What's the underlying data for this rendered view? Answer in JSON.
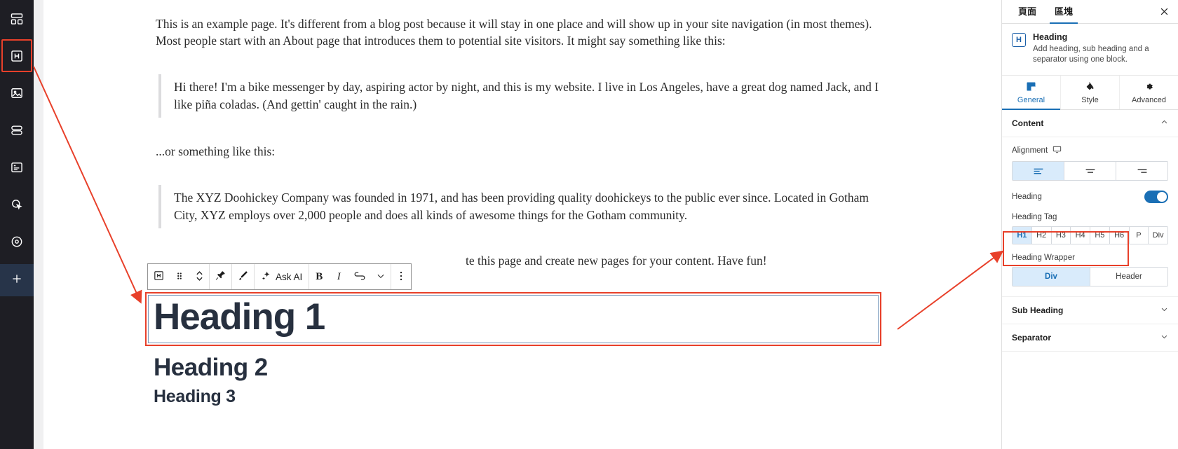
{
  "rail": {
    "items": [
      {
        "name": "layout-icon",
        "label": "Layout"
      },
      {
        "name": "heading-icon",
        "label": "Heading"
      },
      {
        "name": "image-icon",
        "label": "Image"
      },
      {
        "name": "list-icon",
        "label": "List"
      },
      {
        "name": "card-icon",
        "label": "Card"
      },
      {
        "name": "interaction-icon",
        "label": "Interaction"
      },
      {
        "name": "settings-icon",
        "label": "Settings"
      }
    ],
    "add_label": "+"
  },
  "document": {
    "paragraph_1": "This is an example page. It's different from a blog post because it will stay in one place and will show up in your site navigation (in most themes). Most people start with an About page that introduces them to potential site visitors. It might say something like this:",
    "quote_1": "Hi there! I'm a bike messenger by day, aspiring actor by night, and this is my website. I live in Los Angeles, have a great dog named Jack, and I like piña coladas. (And gettin' caught in the rain.)",
    "paragraph_2": "...or something like this:",
    "quote_2": "The XYZ Doohickey Company was founded in 1971, and has been providing quality doohickeys to the public ever since. Located in Gotham City, XYZ employs over 2,000 people and does all kinds of awesome things for the Gotham community.",
    "paragraph_3_tail": "te this page and create new pages for your content. Have fun!",
    "heading_1": "Heading 1",
    "heading_2": "Heading 2",
    "heading_3": "Heading 3"
  },
  "toolbar": {
    "block_type": "H",
    "drag_label": "",
    "move_label": "",
    "pin_label": "",
    "brush_label": "",
    "ask_ai_label": "Ask AI",
    "bold_label": "B",
    "italic_label": "I",
    "link_label": "",
    "more_formats_label": "",
    "options_label": ""
  },
  "panel": {
    "tabs": [
      {
        "label": "頁面",
        "active": false
      },
      {
        "label": "區塊",
        "active": true
      }
    ],
    "close_label": "✕",
    "block": {
      "icon_letter": "H",
      "title": "Heading",
      "description": "Add heading, sub heading and a separator using one block."
    },
    "subtabs": [
      {
        "label": "General",
        "icon": "square-icon",
        "active": true
      },
      {
        "label": "Style",
        "icon": "paint-bucket-icon",
        "active": false
      },
      {
        "label": "Advanced",
        "icon": "gear-icon",
        "active": false
      }
    ],
    "content_section": {
      "title": "Content",
      "chevron": "⌃"
    },
    "alignment": {
      "label": "Alignment",
      "device_icon": "desktop-icon",
      "options": [
        "align-left",
        "align-center",
        "align-right"
      ],
      "selected": 0
    },
    "heading_toggle": {
      "label": "Heading",
      "on": true
    },
    "heading_tag": {
      "label": "Heading Tag",
      "options": [
        "H1",
        "H2",
        "H3",
        "H4",
        "H5",
        "H6",
        "P",
        "Div"
      ],
      "selected": "H1"
    },
    "heading_wrapper": {
      "label": "Heading Wrapper",
      "options": [
        "Div",
        "Header"
      ],
      "selected": "Div"
    },
    "sections": [
      {
        "title": "Sub Heading",
        "chevron": "⌄"
      },
      {
        "title": "Separator",
        "chevron": "⌄"
      }
    ]
  },
  "annotations": {
    "highlight_color": "#e8402a"
  }
}
